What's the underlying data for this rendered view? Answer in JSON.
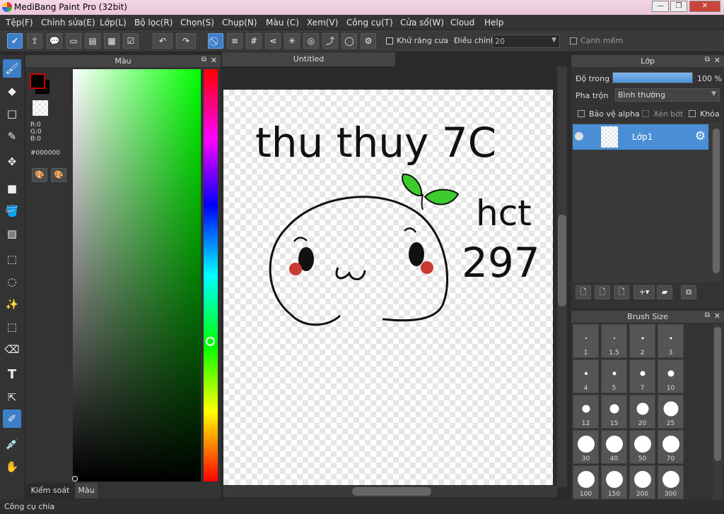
{
  "window": {
    "title": "MediBang Paint Pro (32bit)",
    "minimize": "—",
    "maximize": "❐",
    "close": "✕"
  },
  "menu": [
    "Tệp(F)",
    "Chỉnh sửa(E)",
    "Lớp(L)",
    "Bộ lọc(R)",
    "Chọn(S)",
    "Chụp(N)",
    "Màu (C)",
    "Xem(V)",
    "Công cụ(T)",
    "Cửa sổ(W)",
    "Cloud",
    "Help"
  ],
  "toolbar": {
    "antialias_label": "Khử răng cưa",
    "adjust_label": "Điều chỉnh",
    "adjust_value": "20",
    "soft_edge_label": "Cạnh mềm"
  },
  "color_panel": {
    "title": "Màu",
    "r": "R:0",
    "g": "G:0",
    "b": "B:0",
    "hex": "#000000",
    "tab_brush_control": "Kiểm soát cọ",
    "tab_color": "Màu",
    "fg_color": "#000000",
    "hue_color": "#00ff00"
  },
  "canvas": {
    "tab_title": "Untitled",
    "handwriting_line1": "thu thuy 7C",
    "handwriting_line2": "hct",
    "handwriting_line3": "297"
  },
  "layer_panel": {
    "title": "Lớp",
    "opacity_label": "Độ trong",
    "opacity_value": "100 %",
    "opacity_fraction": 1.0,
    "blend_label": "Pha trộn",
    "blend_value": "Bình thường",
    "protect_alpha": "Bảo vệ alpha",
    "clipping": "Xén bớt",
    "lock": "Khóa",
    "layers": [
      {
        "name": "Lớp1"
      }
    ]
  },
  "brush_panel": {
    "title": "Brush Size",
    "sizes": [
      "1",
      "1.5",
      "2",
      "3",
      "4",
      "5",
      "7",
      "10",
      "12",
      "15",
      "20",
      "25",
      "30",
      "40",
      "50",
      "70",
      "100",
      "150",
      "200",
      "300"
    ]
  },
  "status": {
    "text": "Công cụ chia"
  },
  "accent": "#3d7ec9"
}
